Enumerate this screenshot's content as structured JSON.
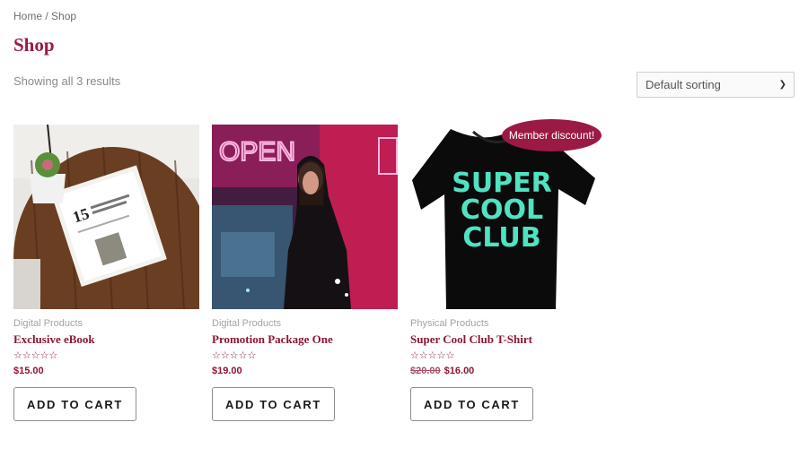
{
  "breadcrumb": {
    "home": "Home",
    "separator": " / ",
    "current": "Shop"
  },
  "page_title": "Shop",
  "result_count": "Showing all 3 results",
  "sorting": {
    "selected": "Default sorting"
  },
  "products": [
    {
      "category": "Digital Products",
      "name": "Exclusive eBook",
      "rating": "☆☆☆☆☆",
      "price": "$15.00",
      "old_price": "",
      "button": "ADD TO CART"
    },
    {
      "category": "Digital Products",
      "name": "Promotion Package One",
      "rating": "☆☆☆☆☆",
      "price": "$19.00",
      "old_price": "",
      "button": "ADD TO CART"
    },
    {
      "category": "Physical Products",
      "name": "Super Cool Club T-Shirt",
      "rating": "☆☆☆☆☆",
      "price": "$16.00",
      "old_price": "$20.00",
      "button": "ADD TO CART",
      "badge": "Member discount!"
    }
  ],
  "tshirt_print": [
    "SUPER",
    "COOL",
    "CLUB"
  ],
  "photo_sign": "OPEN",
  "ebook_cover_number": "15",
  "colors": {
    "accent": "#9b1a44",
    "link": "#8e1536",
    "tshirt_text": "#4fe3c1"
  }
}
